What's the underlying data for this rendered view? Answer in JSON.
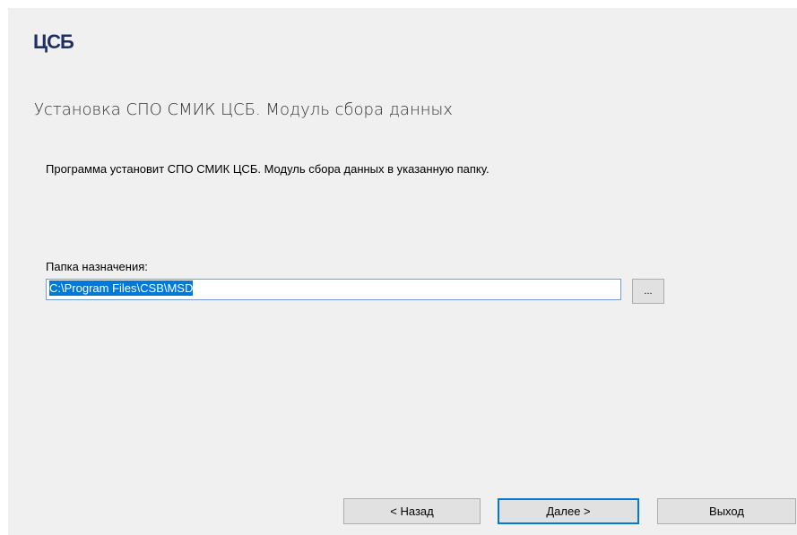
{
  "header": {
    "logo_text": "ЦСБ"
  },
  "page": {
    "title": "Установка СПО СМИК ЦСБ. Модуль сбора данных",
    "description": "Программа установит СПО СМИК ЦСБ. Модуль сбора данных в указанную папку."
  },
  "destination": {
    "label": "Папка назначения:",
    "path_value": "C:\\Program Files\\CSB\\MSD",
    "browse_label": "..."
  },
  "footer": {
    "back_label": "< Назад",
    "next_label": "Далее >",
    "exit_label": "Выход"
  }
}
